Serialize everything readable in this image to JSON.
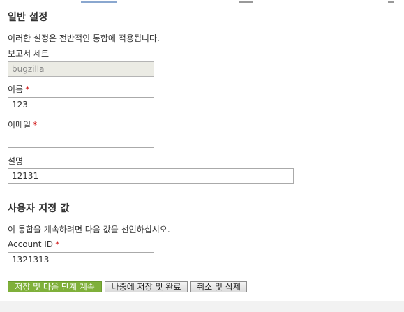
{
  "general": {
    "title": "일반 설정",
    "description": "이러한 설정은 전반적인 통합에 적용됩니다.",
    "report_set": {
      "label": "보고서 세트",
      "value": "bugzilla"
    },
    "name": {
      "label": "이름",
      "required_mark": "*",
      "value": "123"
    },
    "email": {
      "label": "이메일",
      "required_mark": "*",
      "value": ""
    },
    "description_field": {
      "label": "설명",
      "value": "12131"
    }
  },
  "custom": {
    "title": "사용자 지정 값",
    "description": "이 통합을 계속하려면 다음 값을 선언하십시오.",
    "account_id": {
      "label": "Account ID",
      "required_mark": "*",
      "value": "1321313"
    }
  },
  "buttons": {
    "save_next": "저장 및 다음 단계 계속",
    "save_later": "나중에 저장 및 완료",
    "cancel_delete": "취소 및 삭제"
  },
  "colors": {
    "primary_button": "#7fb03a",
    "required": "#cc0000"
  }
}
